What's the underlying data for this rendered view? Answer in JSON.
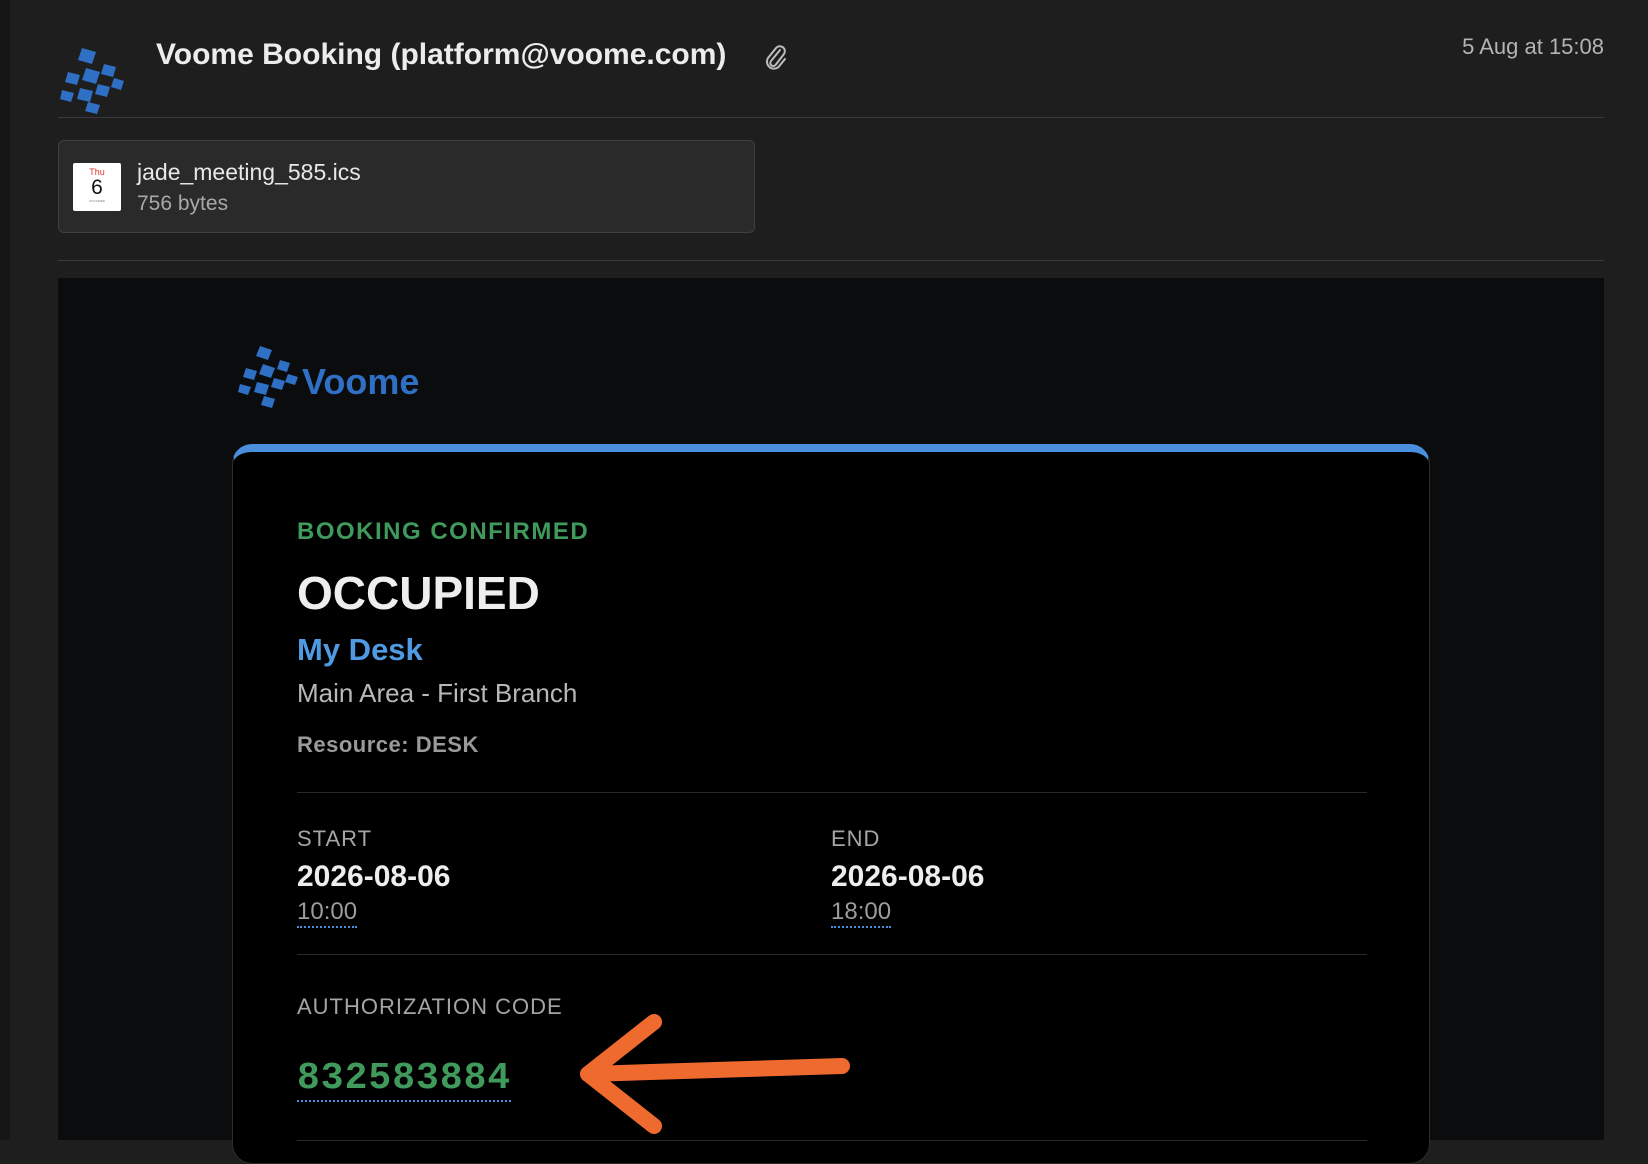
{
  "header": {
    "sender": "Voome Booking (platform@voome.com)",
    "date": "5 Aug at 15:08",
    "logo_icon": "voome-logo-icon",
    "attachment_icon": "paperclip-icon"
  },
  "attachment": {
    "filename": "jade_meeting_585.ics",
    "size": "756 bytes",
    "icon": "calendar-file-icon",
    "icon_dow": "Thu",
    "icon_day": "6",
    "icon_subtext": "OCCUPIED"
  },
  "email": {
    "brand": "Voome",
    "accent_color": "#4a8fdc",
    "status_color": "#3f9a5c",
    "status_label": "BOOKING CONFIRMED",
    "title": "OCCUPIED",
    "resource_name": "My Desk",
    "location": "Main Area - First Branch",
    "resource_type": "Resource: DESK",
    "start": {
      "label": "START",
      "date": "2026-08-06",
      "time": "10:00"
    },
    "end": {
      "label": "END",
      "date": "2026-08-06",
      "time": "18:00"
    },
    "authorization": {
      "label": "AUTHORIZATION CODE",
      "code": "832583884"
    }
  },
  "annotation": {
    "icon": "orange-arrow-icon",
    "color": "#ef6a2e"
  }
}
